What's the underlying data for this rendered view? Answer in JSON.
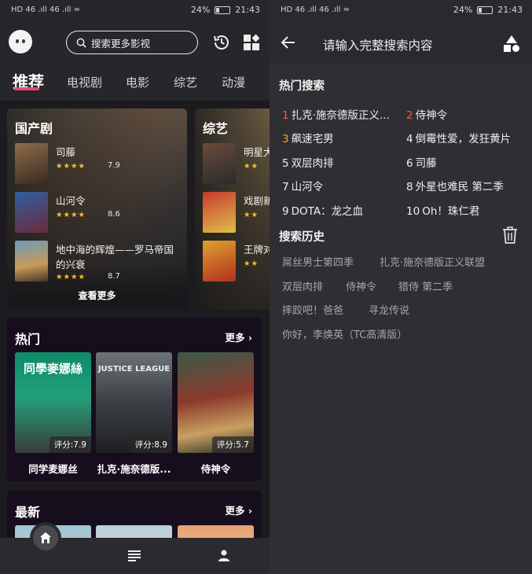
{
  "status_left": {
    "signal": "HD 46 .ıll 46 .ıll ≈",
    "battery": "24%",
    "time": "21:43"
  },
  "status_right": {
    "signal": "HD 46 .ıll 46 .ıll ≈",
    "battery": "24%",
    "time": "21:43"
  },
  "left": {
    "search_placeholder": "搜索更多影视",
    "tabs": [
      "推荐",
      "电视剧",
      "电影",
      "综艺",
      "动漫"
    ],
    "domestic": {
      "title": "国产剧",
      "items": [
        {
          "name": "司藤",
          "stars": "★★★★",
          "score": "7.9"
        },
        {
          "name": "山河令",
          "stars": "★★★★",
          "score": "8.6"
        },
        {
          "name": "地中海的辉煌——罗马帝国的兴衰",
          "stars": "★★★★",
          "score": "8.7"
        }
      ],
      "see_more": "查看更多"
    },
    "variety": {
      "title": "综艺",
      "items": [
        {
          "name": "明星大",
          "stars": "★★"
        },
        {
          "name": "戏剧新",
          "stars": "★★"
        },
        {
          "name": "王牌对",
          "stars": "★★"
        }
      ]
    },
    "hot": {
      "title": "热门",
      "more": "更多",
      "movies": [
        {
          "title": "同学麦娜丝",
          "rating": "评分:7.9",
          "poster_text": "同學麥娜絲"
        },
        {
          "title": "扎克·施奈德版...",
          "rating": "评分:8.9",
          "poster_text": "JUSTICE LEAGUE"
        },
        {
          "title": "侍神令",
          "rating": "评分:5.7",
          "poster_text": ""
        }
      ]
    },
    "latest": {
      "title": "最新",
      "more": "更多"
    }
  },
  "right": {
    "header_title": "请输入完整搜索内容",
    "hot_title": "热门搜索",
    "hot_searches": [
      {
        "num": "1",
        "text": "扎克·施奈德版正义...",
        "color": "#f05a3c"
      },
      {
        "num": "2",
        "text": "侍神令",
        "color": "#f05a3c"
      },
      {
        "num": "3",
        "text": "飙速宅男",
        "color": "#f5a623"
      },
      {
        "num": "4",
        "text": "倒霉性爱，发狂黄片",
        "color": "#f0f0f0"
      },
      {
        "num": "5",
        "text": "双层肉排",
        "color": "#f0f0f0"
      },
      {
        "num": "6",
        "text": "司藤",
        "color": "#f0f0f0"
      },
      {
        "num": "7",
        "text": "山河令",
        "color": "#f0f0f0"
      },
      {
        "num": "8",
        "text": "外星也难民 第二季",
        "color": "#f0f0f0"
      },
      {
        "num": "9",
        "text": "DOTA：龙之血",
        "color": "#f0f0f0"
      },
      {
        "num": "10",
        "text": "Oh！珠仁君",
        "color": "#f0f0f0"
      }
    ],
    "history_title": "搜索历史",
    "history": [
      "屌丝男士第四季",
      "扎克·施奈德版正义联盟",
      "双层肉排",
      "侍神令",
      "猎侍 第二季",
      "摔跤吧！爸爸",
      "寻龙传说",
      "你好，李焕英（TC高清版）"
    ]
  },
  "colors": {
    "accent": "#e54a72",
    "star": "#f6c026",
    "rank1": "#f05a3c",
    "rank3": "#f5a623"
  }
}
